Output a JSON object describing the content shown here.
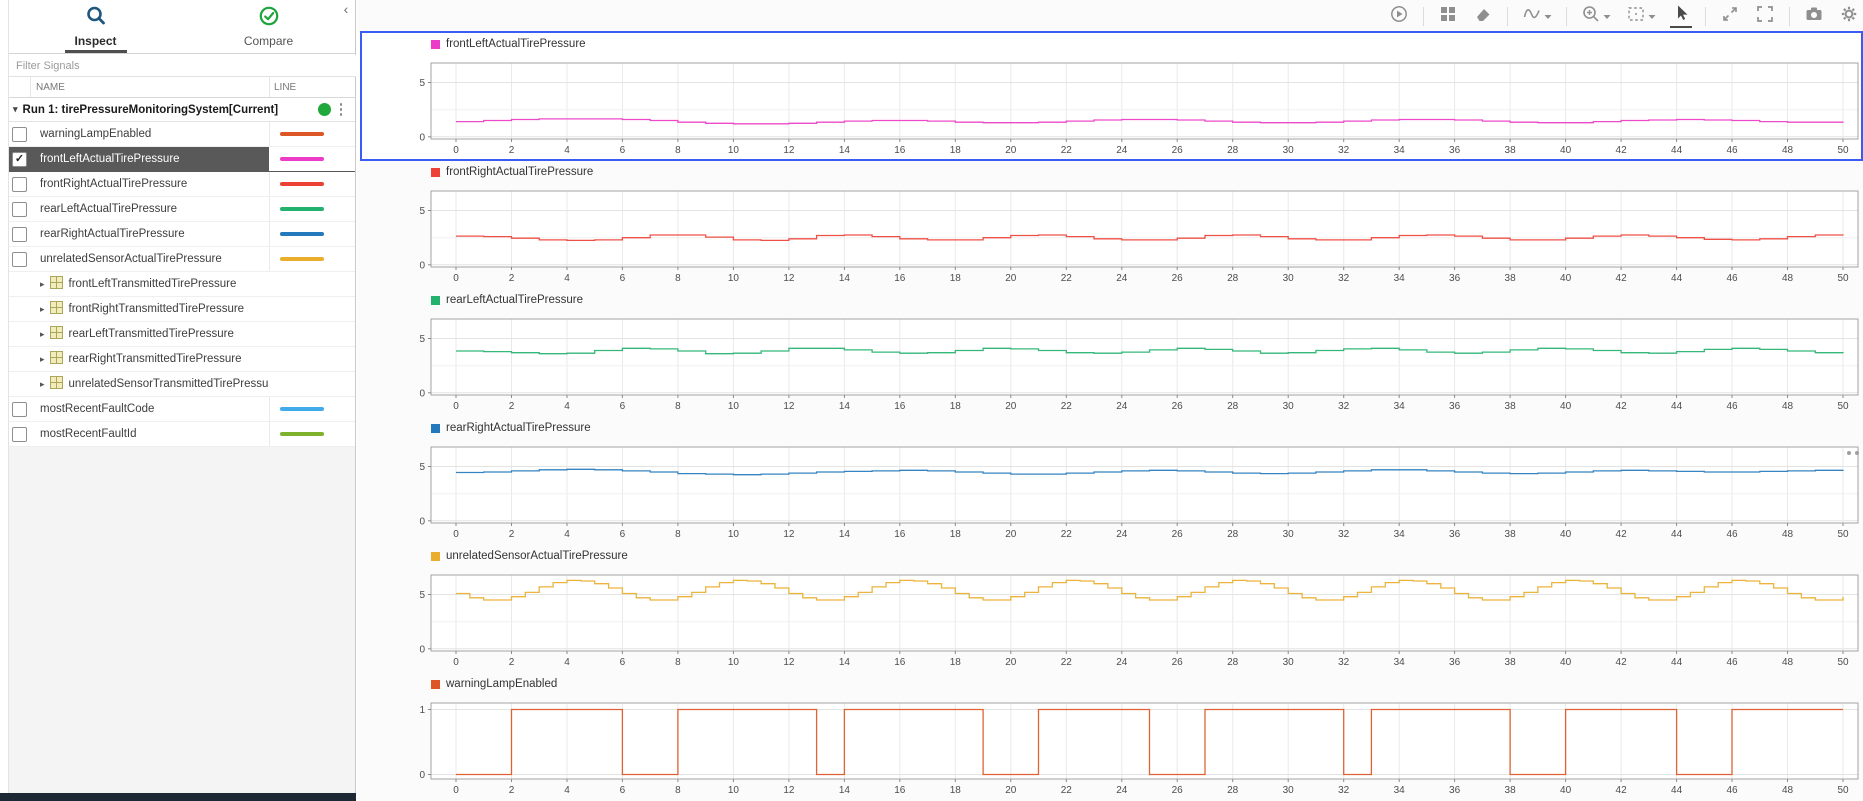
{
  "app": {
    "collapse_chevron": "‹"
  },
  "sidebar": {
    "tabs": [
      {
        "label": "Inspect",
        "icon": "magnifier-icon",
        "active": true
      },
      {
        "label": "Compare",
        "icon": "check-circle-icon",
        "active": false
      }
    ],
    "filter_placeholder": "Filter Signals",
    "columns": {
      "name": "NAME",
      "line": "LINE"
    },
    "run": {
      "label": "Run 1: tirePressureMonitoringSystem[Current]",
      "status_color": "#21a83c",
      "caret": "▾"
    },
    "signals": [
      {
        "name": "warningLampEnabled",
        "kind": "signal",
        "checked": false,
        "selected": false,
        "color": "#dd5626"
      },
      {
        "name": "frontLeftActualTirePressure",
        "kind": "signal",
        "checked": true,
        "selected": true,
        "color": "#ec3bc6"
      },
      {
        "name": "frontRightActualTirePressure",
        "kind": "signal",
        "checked": false,
        "selected": false,
        "color": "#ee4136"
      },
      {
        "name": "rearLeftActualTirePressure",
        "kind": "signal",
        "checked": false,
        "selected": false,
        "color": "#23b26e"
      },
      {
        "name": "rearRightActualTirePressure",
        "kind": "signal",
        "checked": false,
        "selected": false,
        "color": "#2478bc"
      },
      {
        "name": "unrelatedSensorActualTirePressure",
        "kind": "signal",
        "checked": false,
        "selected": false,
        "color": "#eaad2c"
      },
      {
        "name": "frontLeftTransmittedTirePressure",
        "kind": "bus"
      },
      {
        "name": "frontRightTransmittedTirePressure",
        "kind": "bus"
      },
      {
        "name": "rearLeftTransmittedTirePressure",
        "kind": "bus"
      },
      {
        "name": "rearRightTransmittedTirePressure",
        "kind": "bus"
      },
      {
        "name": "unrelatedSensorTransmittedTirePressu",
        "kind": "bus"
      },
      {
        "name": "mostRecentFaultCode",
        "kind": "signal",
        "checked": false,
        "selected": false,
        "color": "#41aaeb"
      },
      {
        "name": "mostRecentFaultId",
        "kind": "signal",
        "checked": false,
        "selected": false,
        "color": "#7eb22c"
      }
    ]
  },
  "toolbar": {
    "groups": [
      [
        {
          "icon": "replay-icon"
        }
      ],
      [
        {
          "icon": "layout-grid-icon"
        },
        {
          "icon": "eraser-icon"
        }
      ],
      [
        {
          "icon": "signal-trace-icon",
          "caret": true
        }
      ],
      [
        {
          "icon": "zoom-in-icon",
          "caret": true
        },
        {
          "icon": "fit-to-view-icon",
          "caret": true
        },
        {
          "icon": "arrow-cursor-icon",
          "selected": true
        }
      ],
      [
        {
          "icon": "expand-diagonal-icon"
        },
        {
          "icon": "fullscreen-icon"
        }
      ],
      [
        {
          "icon": "camera-icon"
        },
        {
          "icon": "gear-icon"
        }
      ]
    ]
  },
  "chart_data": [
    {
      "type": "line",
      "title": "frontLeftActualTirePressure",
      "color": "#ec3bc6",
      "xlim": [
        0,
        50
      ],
      "xtick_step": 2,
      "ylim": [
        -0.2,
        6.8
      ],
      "yticks": [
        0,
        5
      ],
      "grid_minor": [
        2.5
      ],
      "x_start": 0,
      "x_step": 1,
      "values": [
        1.4,
        1.5,
        1.6,
        1.65,
        1.65,
        1.65,
        1.6,
        1.5,
        1.35,
        1.25,
        1.2,
        1.2,
        1.25,
        1.35,
        1.45,
        1.5,
        1.5,
        1.45,
        1.35,
        1.3,
        1.3,
        1.35,
        1.45,
        1.55,
        1.6,
        1.6,
        1.55,
        1.45,
        1.35,
        1.3,
        1.3,
        1.35,
        1.45,
        1.55,
        1.6,
        1.6,
        1.55,
        1.45,
        1.35,
        1.3,
        1.3,
        1.4,
        1.5,
        1.55,
        1.6,
        1.55,
        1.5,
        1.4,
        1.35,
        1.35,
        1.4
      ]
    },
    {
      "type": "line",
      "title": "frontRightActualTirePressure",
      "color": "#ee4136",
      "xlim": [
        0,
        50
      ],
      "xtick_step": 2,
      "ylim": [
        -0.2,
        6.8
      ],
      "yticks": [
        0,
        5
      ],
      "grid_minor": [
        2.5
      ],
      "x_start": 0,
      "x_step": 1,
      "values": [
        2.65,
        2.6,
        2.45,
        2.3,
        2.25,
        2.3,
        2.5,
        2.75,
        2.75,
        2.55,
        2.3,
        2.25,
        2.4,
        2.7,
        2.75,
        2.6,
        2.4,
        2.3,
        2.3,
        2.5,
        2.7,
        2.75,
        2.6,
        2.4,
        2.3,
        2.3,
        2.45,
        2.7,
        2.75,
        2.6,
        2.4,
        2.3,
        2.3,
        2.5,
        2.7,
        2.75,
        2.65,
        2.45,
        2.3,
        2.3,
        2.45,
        2.65,
        2.75,
        2.65,
        2.5,
        2.35,
        2.3,
        2.4,
        2.6,
        2.75,
        2.7
      ]
    },
    {
      "type": "line",
      "title": "rearLeftActualTirePressure",
      "color": "#23b26e",
      "xlim": [
        0,
        50
      ],
      "xtick_step": 2,
      "ylim": [
        -0.2,
        6.8
      ],
      "yticks": [
        0,
        5
      ],
      "grid_minor": [
        2.5
      ],
      "x_start": 0,
      "x_step": 1,
      "values": [
        3.85,
        3.8,
        3.7,
        3.6,
        3.65,
        3.9,
        4.1,
        4.05,
        3.85,
        3.6,
        3.65,
        3.85,
        4.1,
        4.1,
        3.95,
        3.75,
        3.65,
        3.7,
        3.9,
        4.1,
        4.05,
        3.9,
        3.7,
        3.65,
        3.75,
        3.95,
        4.1,
        4.0,
        3.85,
        3.65,
        3.7,
        3.9,
        4.05,
        4.1,
        3.95,
        3.75,
        3.65,
        3.75,
        3.95,
        4.1,
        4.05,
        3.9,
        3.7,
        3.65,
        3.8,
        4.0,
        4.1,
        4.0,
        3.85,
        3.7,
        3.65
      ]
    },
    {
      "type": "line",
      "title": "rearRightActualTirePressure",
      "color": "#2478bc",
      "xlim": [
        0,
        50
      ],
      "xtick_step": 2,
      "ylim": [
        -0.2,
        6.8
      ],
      "yticks": [
        0,
        5
      ],
      "grid_minor": [
        2.5
      ],
      "x_start": 0,
      "x_step": 1,
      "values": [
        4.45,
        4.5,
        4.6,
        4.7,
        4.75,
        4.7,
        4.6,
        4.5,
        4.35,
        4.3,
        4.25,
        4.3,
        4.4,
        4.5,
        4.55,
        4.6,
        4.65,
        4.6,
        4.5,
        4.4,
        4.3,
        4.3,
        4.4,
        4.5,
        4.6,
        4.65,
        4.6,
        4.5,
        4.4,
        4.35,
        4.4,
        4.5,
        4.6,
        4.7,
        4.7,
        4.6,
        4.5,
        4.4,
        4.35,
        4.4,
        4.5,
        4.6,
        4.65,
        4.6,
        4.55,
        4.5,
        4.5,
        4.55,
        4.6,
        4.65,
        4.7
      ]
    },
    {
      "type": "line",
      "title": "unrelatedSensorActualTirePressure",
      "color": "#eaad2c",
      "xlim": [
        0,
        50
      ],
      "xtick_step": 2,
      "ylim": [
        -0.2,
        6.8
      ],
      "yticks": [
        0,
        5
      ],
      "grid_minor": [
        2.5
      ],
      "x_start": 0,
      "x_step": 0.5,
      "values": [
        5.1,
        4.7,
        4.5,
        4.5,
        4.8,
        5.2,
        5.7,
        6.1,
        6.3,
        6.25,
        6.0,
        5.6,
        5.1,
        4.7,
        4.5,
        4.5,
        4.8,
        5.2,
        5.7,
        6.1,
        6.3,
        6.25,
        6.0,
        5.6,
        5.1,
        4.7,
        4.5,
        4.5,
        4.8,
        5.2,
        5.7,
        6.1,
        6.3,
        6.25,
        6.0,
        5.6,
        5.1,
        4.7,
        4.5,
        4.5,
        4.8,
        5.2,
        5.7,
        6.1,
        6.3,
        6.25,
        6.0,
        5.6,
        5.1,
        4.7,
        4.5,
        4.5,
        4.8,
        5.2,
        5.7,
        6.1,
        6.3,
        6.25,
        6.0,
        5.6,
        5.1,
        4.7,
        4.5,
        4.5,
        4.8,
        5.2,
        5.7,
        6.1,
        6.3,
        6.25,
        6.0,
        5.6,
        5.1,
        4.7,
        4.5,
        4.5,
        4.8,
        5.2,
        5.7,
        6.1,
        6.3,
        6.25,
        6.0,
        5.6,
        5.1,
        4.7,
        4.5,
        4.5,
        4.8,
        5.2,
        5.7,
        6.1,
        6.3,
        6.25,
        6.0,
        5.6,
        5.1,
        4.7,
        4.5,
        4.5,
        4.8
      ]
    },
    {
      "type": "step",
      "title": "warningLampEnabled",
      "color": "#dd5626",
      "xlim": [
        0,
        50
      ],
      "xtick_step": 2,
      "ylim": [
        -0.07,
        1.1
      ],
      "yticks": [
        0,
        1
      ],
      "grid_minor": [],
      "points": [
        [
          0,
          0
        ],
        [
          2,
          1
        ],
        [
          6,
          0
        ],
        [
          8,
          1
        ],
        [
          13,
          0
        ],
        [
          14,
          1
        ],
        [
          19,
          0
        ],
        [
          21,
          1
        ],
        [
          25,
          0
        ],
        [
          27,
          1
        ],
        [
          32,
          0
        ],
        [
          33,
          1
        ],
        [
          38,
          0
        ],
        [
          40,
          1
        ],
        [
          44,
          0
        ],
        [
          46,
          1
        ],
        [
          50,
          1
        ]
      ]
    }
  ]
}
